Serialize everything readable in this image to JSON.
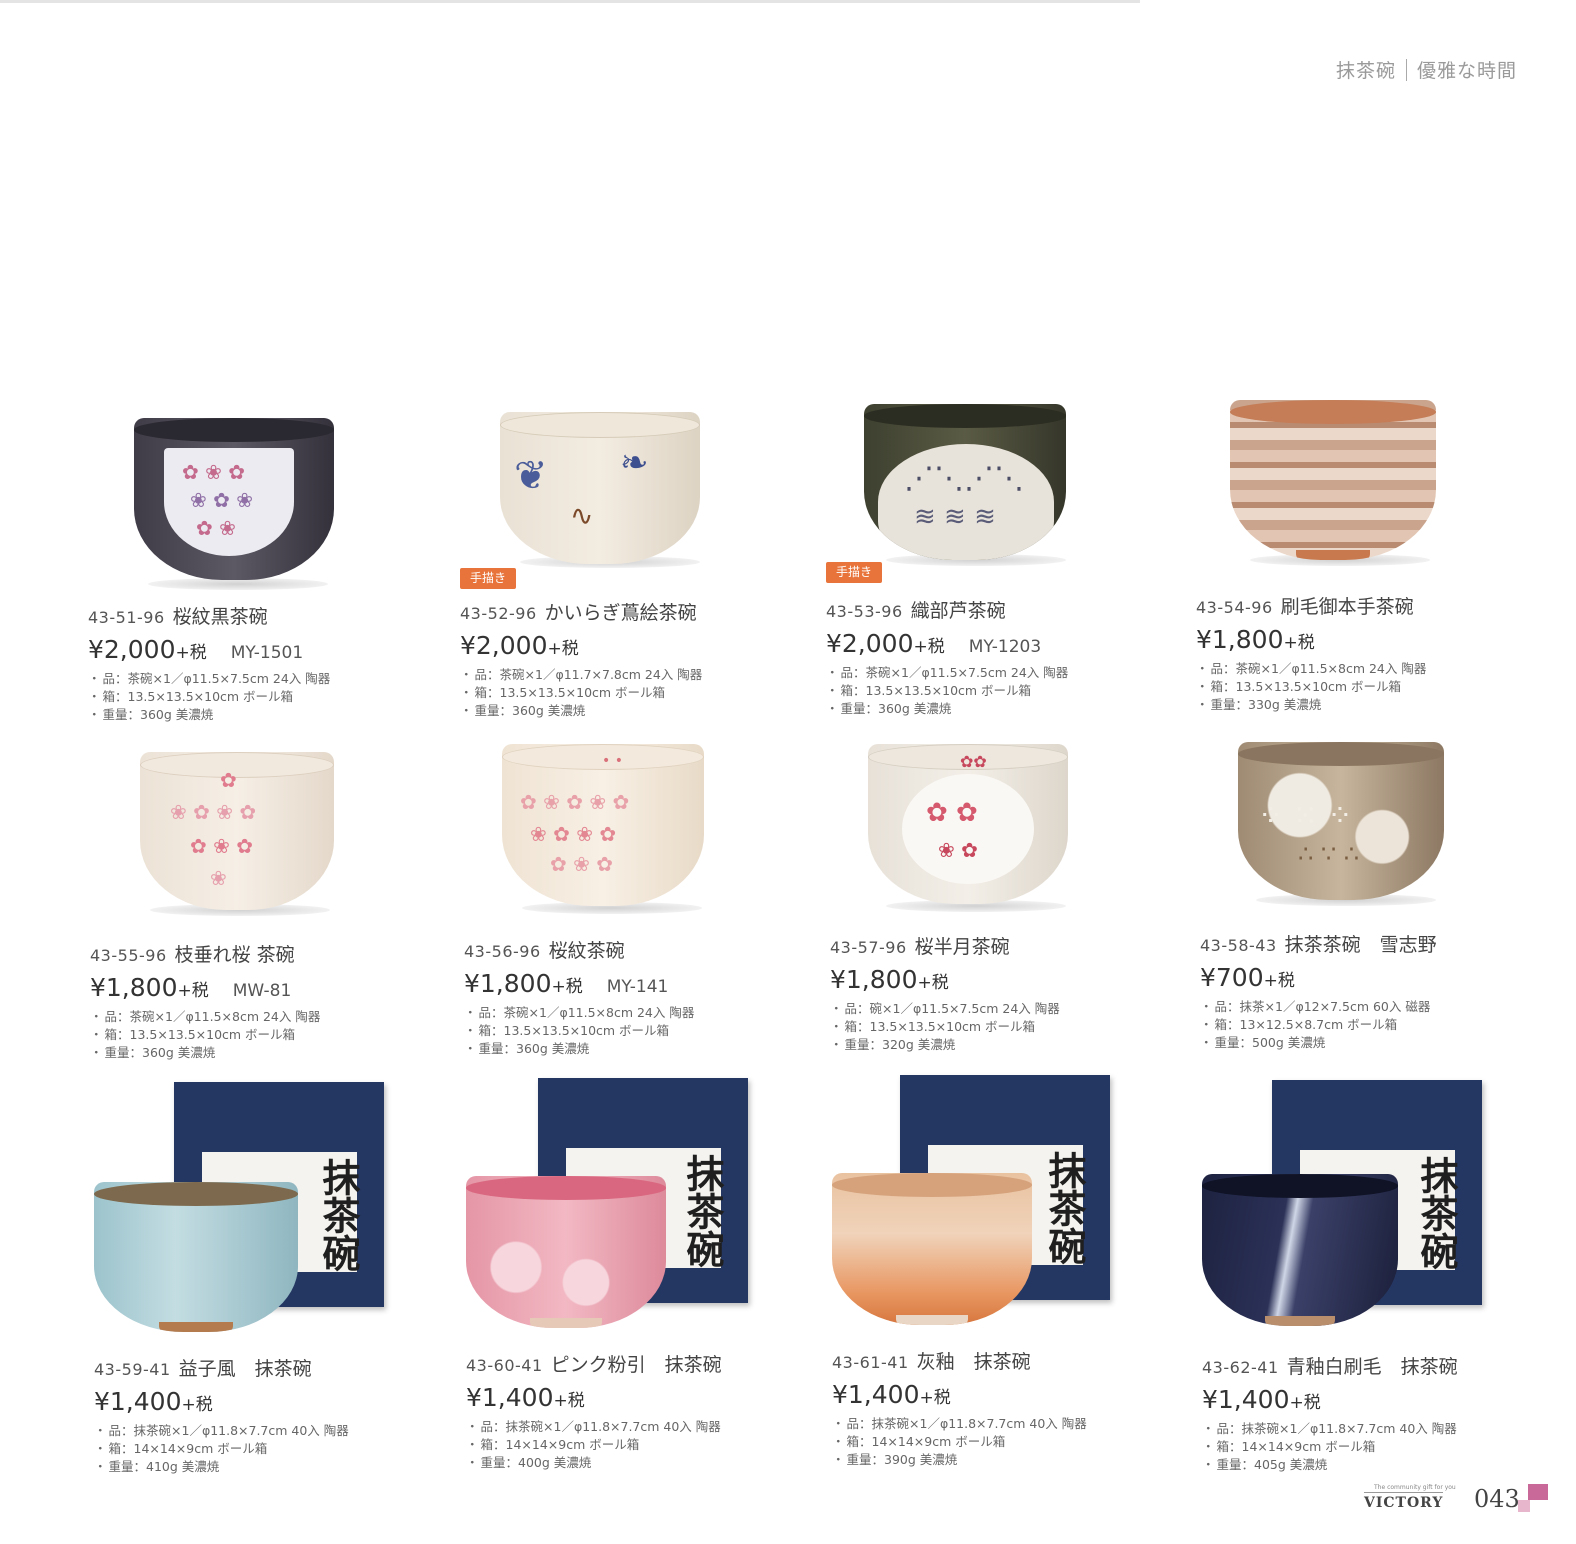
{
  "header": {
    "category": "抹茶碗",
    "subtitle": "優雅な時間"
  },
  "badge_label": "手描き",
  "products": [
    {
      "code": "43-51-96",
      "name": "桜紋黒茶碗",
      "price": "¥2,000",
      "tax": "+税",
      "model": "MY-1501",
      "specs": [
        "品：茶碗×1／φ11.5×7.5cm 24入 陶器",
        "箱：13.5×13.5×10cm ボール箱",
        "重量：360g 美濃焼"
      ]
    },
    {
      "code": "43-52-96",
      "name": "かいらぎ蔦絵茶碗",
      "price": "¥2,000",
      "tax": "+税",
      "model": "",
      "badge": true,
      "specs": [
        "品：茶碗×1／φ11.7×7.8cm 24入 陶器",
        "箱：13.5×13.5×10cm ボール箱",
        "重量：360g 美濃焼"
      ]
    },
    {
      "code": "43-53-96",
      "name": "織部芦茶碗",
      "price": "¥2,000",
      "tax": "+税",
      "model": "MY-1203",
      "badge": true,
      "specs": [
        "品：茶碗×1／φ11.5×7.5cm 24入 陶器",
        "箱：13.5×13.5×10cm ボール箱",
        "重量：360g 美濃焼"
      ]
    },
    {
      "code": "43-54-96",
      "name": "刷毛御本手茶碗",
      "price": "¥1,800",
      "tax": "+税",
      "model": "",
      "specs": [
        "品：茶碗×1／φ11.5×8cm 24入 陶器",
        "箱：13.5×13.5×10cm ボール箱",
        "重量：330g 美濃焼"
      ]
    },
    {
      "code": "43-55-96",
      "name": "枝垂れ桜 茶碗",
      "price": "¥1,800",
      "tax": "+税",
      "model": "MW-81",
      "specs": [
        "品：茶碗×1／φ11.5×8cm 24入 陶器",
        "箱：13.5×13.5×10cm ボール箱",
        "重量：360g 美濃焼"
      ]
    },
    {
      "code": "43-56-96",
      "name": "桜紋茶碗",
      "price": "¥1,800",
      "tax": "+税",
      "model": "MY-141",
      "specs": [
        "品：茶碗×1／φ11.5×8cm 24入 陶器",
        "箱：13.5×13.5×10cm ボール箱",
        "重量：360g 美濃焼"
      ]
    },
    {
      "code": "43-57-96",
      "name": "桜半月茶碗",
      "price": "¥1,800",
      "tax": "+税",
      "model": "",
      "specs": [
        "品：碗×1／φ11.5×7.5cm 24入 陶器",
        "箱：13.5×13.5×10cm ボール箱",
        "重量：320g 美濃焼"
      ]
    },
    {
      "code": "43-58-43",
      "name": "抹茶茶碗　雪志野",
      "price": "¥700",
      "tax": "+税",
      "model": "",
      "specs": [
        "品：抹茶×1／φ12×7.5cm 60入 磁器",
        "箱：13×12.5×8.7cm ボール箱",
        "重量：500g 美濃焼"
      ]
    },
    {
      "code": "43-59-41",
      "name": "益子風　抹茶碗",
      "price": "¥1,400",
      "tax": "+税",
      "model": "",
      "specs": [
        "品：抹茶碗×1／φ11.8×7.7cm 40入 陶器",
        "箱：14×14×9cm ボール箱",
        "重量：410g 美濃焼"
      ]
    },
    {
      "code": "43-60-41",
      "name": "ピンク粉引　抹茶碗",
      "price": "¥1,400",
      "tax": "+税",
      "model": "",
      "specs": [
        "品：抹茶碗×1／φ11.8×7.7cm 40入 陶器",
        "箱：14×14×9cm ボール箱",
        "重量：400g 美濃焼"
      ]
    },
    {
      "code": "43-61-41",
      "name": "灰釉　抹茶碗",
      "price": "¥1,400",
      "tax": "+税",
      "model": "",
      "specs": [
        "品：抹茶碗×1／φ11.8×7.7cm 40入 陶器",
        "箱：14×14×9cm ボール箱",
        "重量：390g 美濃焼"
      ]
    },
    {
      "code": "43-62-41",
      "name": "青釉白刷毛　抹茶碗",
      "price": "¥1,400",
      "tax": "+税",
      "model": "",
      "specs": [
        "品：抹茶碗×1／φ11.8×7.7cm 40入 陶器",
        "箱：14×14×9cm ボール箱",
        "重量：405g 美濃焼"
      ]
    }
  ],
  "box_label": "抹茶碗",
  "footer": {
    "tagline": "The community gift for you",
    "brand": "VICTORY",
    "page_number": "043"
  },
  "colors": {
    "badge": "#e8743b",
    "box": "#243763",
    "page_mark": "#c9699a"
  }
}
